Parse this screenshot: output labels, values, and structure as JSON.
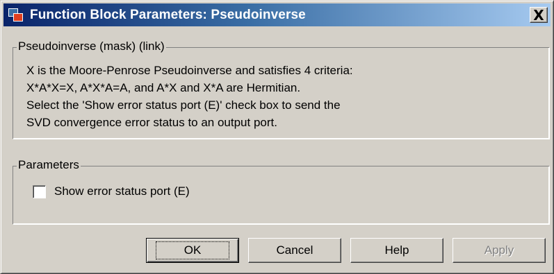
{
  "window": {
    "title": "Function Block Parameters: Pseudoinverse",
    "close_label": "X"
  },
  "description_group": {
    "legend": "Pseudoinverse (mask) (link)",
    "lines": [
      "X is the Moore-Penrose Pseudoinverse and satisfies 4 criteria:",
      "X*A*X=X, A*X*A=A, and A*X and X*A are Hermitian.",
      "Select the 'Show error status port (E)' check box to send the",
      "SVD convergence error status to an output port."
    ]
  },
  "parameters_group": {
    "legend": "Parameters",
    "show_error_status_port": {
      "label": "Show error status port (E)",
      "checked": false
    }
  },
  "buttons": {
    "ok": "OK",
    "cancel": "Cancel",
    "help": "Help",
    "apply": "Apply"
  },
  "icons": {
    "app": "simulink-block-icon",
    "close": "close-icon"
  },
  "colors": {
    "titlebar_start": "#0a246a",
    "titlebar_end": "#a6caf0",
    "dialog_face": "#d4d0c8",
    "disabled_text": "#808080"
  }
}
